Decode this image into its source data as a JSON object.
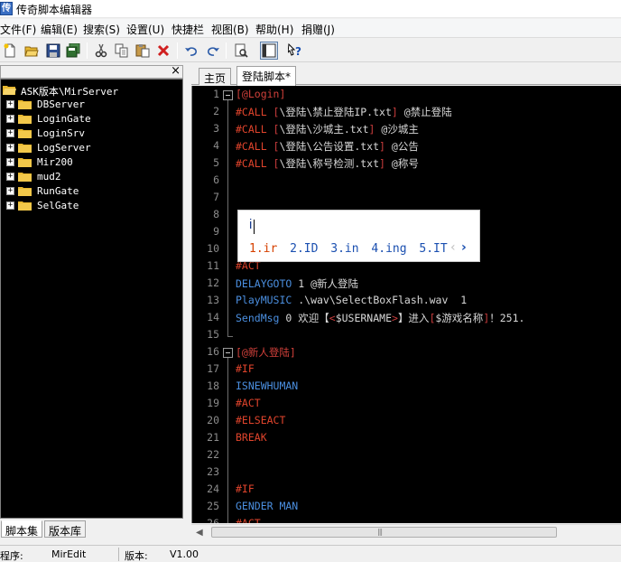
{
  "window": {
    "title": "传奇脚本编辑器",
    "icon": "app-icon"
  },
  "menu": [
    "文件(F)",
    "编辑(E)",
    "搜索(S)",
    "设置(U)",
    "快捷栏",
    "视图(B)",
    "帮助(H)",
    "捐赠(J)"
  ],
  "toolbar": [
    {
      "icon": "new-file-icon"
    },
    {
      "icon": "open-folder-icon"
    },
    {
      "icon": "save-icon"
    },
    {
      "icon": "save-all-icon"
    },
    {
      "icon": "cut-icon"
    },
    {
      "icon": "copy-icon"
    },
    {
      "icon": "paste-icon"
    },
    {
      "icon": "delete-icon"
    },
    {
      "icon": "undo-icon"
    },
    {
      "icon": "redo-icon"
    },
    {
      "icon": "preview-icon"
    },
    {
      "icon": "toggle-panel-icon"
    },
    {
      "icon": "help-icon"
    }
  ],
  "tree": {
    "root": "ASK版本\\MirServer",
    "items": [
      "DBServer",
      "LoginGate",
      "LoginSrv",
      "LogServer",
      "Mir200",
      "mud2",
      "RunGate",
      "SelGate"
    ]
  },
  "left_tabs": [
    "脚本集",
    "版本库"
  ],
  "editor_tabs": [
    "主页",
    "登陆脚本*"
  ],
  "code_lines": [
    [
      {
        "t": "[@Login]",
        "c": "sec"
      }
    ],
    [
      {
        "t": "#CALL ",
        "c": "kw"
      },
      {
        "t": "[",
        "c": "br"
      },
      {
        "t": "\\登陆\\禁止登陆IP.txt",
        "c": "txt"
      },
      {
        "t": "]",
        "c": "br"
      },
      {
        "t": " @禁止登陆",
        "c": "txt"
      }
    ],
    [
      {
        "t": "#CALL ",
        "c": "kw"
      },
      {
        "t": "[",
        "c": "br"
      },
      {
        "t": "\\登陆\\沙城主.txt",
        "c": "txt"
      },
      {
        "t": "]",
        "c": "br"
      },
      {
        "t": " @沙城主",
        "c": "txt"
      }
    ],
    [
      {
        "t": "#CALL ",
        "c": "kw"
      },
      {
        "t": "[",
        "c": "br"
      },
      {
        "t": "\\登陆\\公告设置.txt",
        "c": "txt"
      },
      {
        "t": "]",
        "c": "br"
      },
      {
        "t": " @公告",
        "c": "txt"
      }
    ],
    [
      {
        "t": "#CALL ",
        "c": "kw"
      },
      {
        "t": "[",
        "c": "br"
      },
      {
        "t": "\\登陆\\称号检测.txt",
        "c": "txt"
      },
      {
        "t": "]",
        "c": "br"
      },
      {
        "t": " @称号",
        "c": "txt"
      }
    ],
    [],
    [],
    [],
    [],
    [],
    [
      {
        "t": "#ACT",
        "c": "kw"
      }
    ],
    [
      {
        "t": "DELAYGOTO",
        "c": "cmd"
      },
      {
        "t": " 1 @新人登陆",
        "c": "txt"
      }
    ],
    [
      {
        "t": "PlayMUSIC",
        "c": "cmd"
      },
      {
        "t": " .\\wav\\SelectBoxFlash.wav  1",
        "c": "txt"
      }
    ],
    [
      {
        "t": "SendMsg",
        "c": "cmd"
      },
      {
        "t": " 0 欢迎【",
        "c": "txt"
      },
      {
        "t": "<",
        "c": "br"
      },
      {
        "t": "$USERNAME",
        "c": "txt"
      },
      {
        "t": ">",
        "c": "br"
      },
      {
        "t": "】进入",
        "c": "txt"
      },
      {
        "t": "[",
        "c": "br"
      },
      {
        "t": "$游戏名称",
        "c": "txt"
      },
      {
        "t": "]",
        "c": "br"
      },
      {
        "t": "！251.",
        "c": "txt"
      }
    ],
    [],
    [
      {
        "t": "[@新人登陆]",
        "c": "sec"
      }
    ],
    [
      {
        "t": "#IF",
        "c": "kw"
      }
    ],
    [
      {
        "t": "ISNEWHUMAN",
        "c": "cmd"
      }
    ],
    [
      {
        "t": "#ACT",
        "c": "kw"
      }
    ],
    [
      {
        "t": "#ELSEACT",
        "c": "kw"
      }
    ],
    [
      {
        "t": "BREAK",
        "c": "kw"
      }
    ],
    [],
    [],
    [
      {
        "t": "#IF",
        "c": "kw"
      }
    ],
    [
      {
        "t": "GENDER MAN",
        "c": "cmd"
      }
    ],
    [
      {
        "t": "#ACT",
        "c": "kw"
      }
    ]
  ],
  "autocomplete": {
    "typed": "i",
    "candidates": [
      "1.ir",
      "2.ID",
      "3.in",
      "4.ing",
      "5.IT"
    ],
    "prev": "‹",
    "next": "›"
  },
  "statusbar": {
    "label1": "程序:",
    "value1": "MirEdit",
    "label2": "版本:",
    "value2": "V1.00"
  },
  "colors": {
    "keyword": "#e0442c",
    "command": "#4b8fe0",
    "bracket": "#c83c3c",
    "text": "#d8d8d8",
    "editor_bg": "#000000"
  }
}
